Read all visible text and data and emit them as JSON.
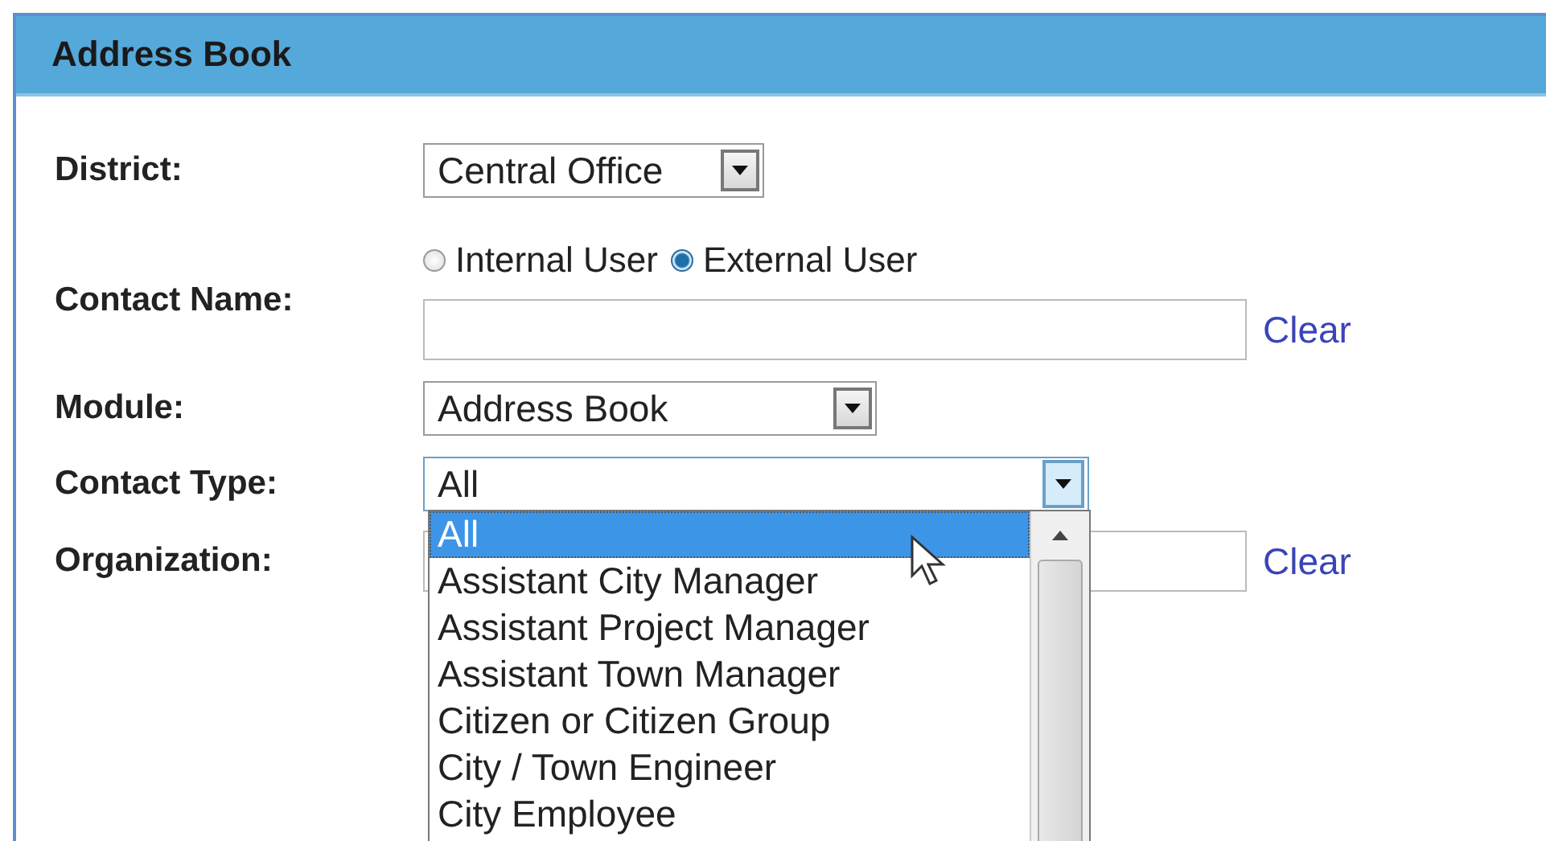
{
  "title": "Address Book",
  "district": {
    "label": "District:",
    "value": "Central Office"
  },
  "contact_name": {
    "label": "Contact Name:",
    "options": [
      {
        "label": "Internal User",
        "selected": false
      },
      {
        "label": "External User",
        "selected": true
      }
    ],
    "clear": "Clear"
  },
  "module": {
    "label": "Module:",
    "value": "Address Book"
  },
  "contact_type": {
    "label": "Contact Type:",
    "value": "All",
    "options": [
      {
        "label": "All",
        "selected": true
      },
      {
        "label": "Assistant City Manager",
        "selected": false
      },
      {
        "label": "Assistant Project Manager",
        "selected": false
      },
      {
        "label": "Assistant Town Manager",
        "selected": false
      },
      {
        "label": "Citizen or Citizen Group",
        "selected": false
      },
      {
        "label": "City / Town Engineer",
        "selected": false
      },
      {
        "label": "City Employee",
        "selected": false
      }
    ]
  },
  "organization": {
    "label": "Organization:",
    "clear": "Clear"
  }
}
